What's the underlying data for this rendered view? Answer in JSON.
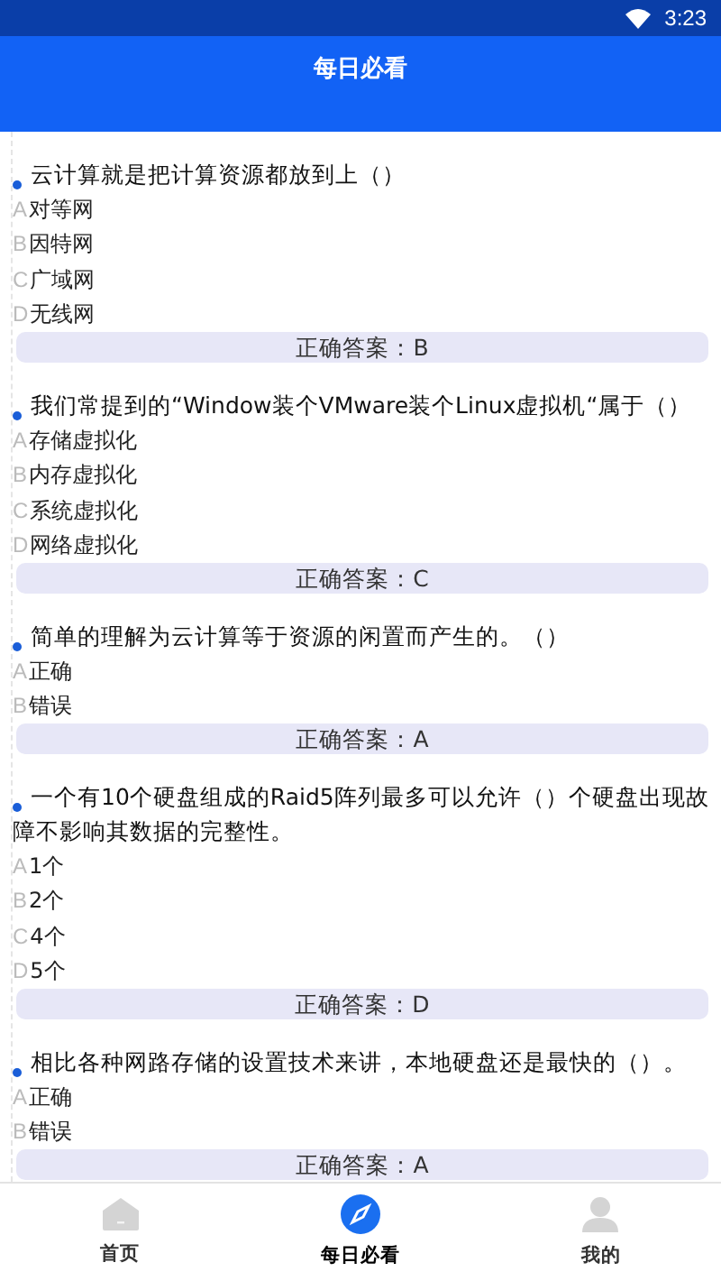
{
  "status_bar": {
    "time": "3:23"
  },
  "header": {
    "title": "每日必看"
  },
  "questions": [
    {
      "text": "云计算就是把计算资源都放到上（）",
      "options": [
        {
          "letter": "A",
          "text": "对等网"
        },
        {
          "letter": "B",
          "text": "因特网"
        },
        {
          "letter": "C",
          "text": "广域网"
        },
        {
          "letter": "D",
          "text": "无线网"
        }
      ],
      "answer": "正确答案：B"
    },
    {
      "text": "我们常提到的“Window装个VMware装个Linux虚拟机“属于（）",
      "options": [
        {
          "letter": "A",
          "text": "存储虚拟化"
        },
        {
          "letter": "B",
          "text": "内存虚拟化"
        },
        {
          "letter": "C",
          "text": "系统虚拟化"
        },
        {
          "letter": "D",
          "text": "网络虚拟化"
        }
      ],
      "answer": "正确答案：C"
    },
    {
      "text": "简单的理解为云计算等于资源的闲置而产生的。（）",
      "options": [
        {
          "letter": "A",
          "text": "正确"
        },
        {
          "letter": "B",
          "text": "错误"
        }
      ],
      "answer": "正确答案：A"
    },
    {
      "text": "一个有10个硬盘组成的Raid5阵列最多可以允许（）个硬盘出现故障不影响其数据的完整性。",
      "options": [
        {
          "letter": "A",
          "text": "1个"
        },
        {
          "letter": "B",
          "text": "2个"
        },
        {
          "letter": "C",
          "text": "4个"
        },
        {
          "letter": "D",
          "text": "5个"
        }
      ],
      "answer": "正确答案：D"
    },
    {
      "text": "相比各种网路存储的设置技术来讲，本地硬盘还是最快的（）。",
      "options": [
        {
          "letter": "A",
          "text": "正确"
        },
        {
          "letter": "B",
          "text": "错误"
        }
      ],
      "answer": "正确答案：A"
    }
  ],
  "nav": [
    {
      "label": "首页",
      "kind": "home",
      "selected": false
    },
    {
      "label": "每日必看",
      "kind": "compass",
      "selected": true
    },
    {
      "label": "我的",
      "kind": "person",
      "selected": false
    }
  ]
}
